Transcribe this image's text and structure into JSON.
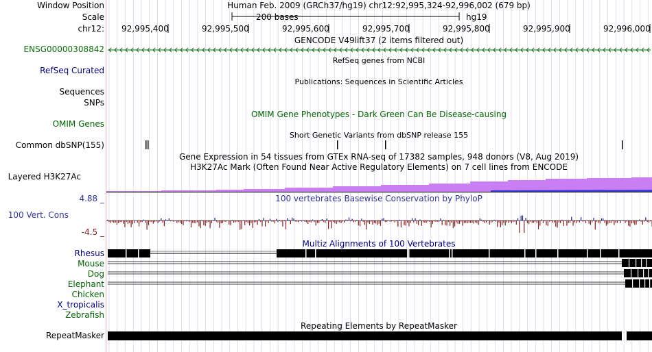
{
  "header": {
    "window_position_label": "Window Position",
    "window_position_value": "Human Feb. 2009 (GRCh37/hg19)   chr12:92,995,324-92,996,002 (679 bp)",
    "scale_label": "Scale",
    "scale_bar_text": "200 bases",
    "scale_assembly": "hg19",
    "chrom_label": "chr12:"
  },
  "ruler_ticks": [
    "92,995,400",
    "92,995,500",
    "92,995,600",
    "92,995,700",
    "92,995,800",
    "92,995,900",
    "92,996,000"
  ],
  "tracks": {
    "gencode": {
      "title": "GENCODE V49lift37 (2 items filtered out)",
      "item": "ENSG00000308842"
    },
    "refseq": {
      "label": "RefSeq Curated",
      "title": "RefSeq genes from NCBI"
    },
    "publications": {
      "label_line1": "Sequences",
      "label_line2": "SNPs",
      "title": "Publications: Sequences in Scientific Articles"
    },
    "omim": {
      "label": "OMIM Genes",
      "title": "OMIM Gene Phenotypes - Dark Green Can Be Disease-causing"
    },
    "dbsnp": {
      "label": "Common dbSNP(155)",
      "title": "Short Genetic Variants from dbSNP release 155"
    },
    "gtex": {
      "title": "Gene Expression in 54 tissues from GTEx RNA-seq of 17382 samples, 948 donors (V8, Aug 2019)"
    },
    "h3k27ac": {
      "label": "Layered H3K27Ac",
      "title": "H3K27Ac Mark (Often Found Near Active Regulatory Elements) on 7 cell lines from ENCODE"
    },
    "conservation": {
      "max_label": "4.88 _",
      "label": "100 Vert. Cons",
      "min_label": "-4.5 _",
      "title": "100 vertebrates Basewise Conservation by PhyloP"
    },
    "multiz": {
      "title": "Multiz Alignments of 100 Vertebrates",
      "species": [
        "Rhesus",
        "Mouse",
        "Dog",
        "Elephant",
        "Chicken",
        "X_tropicalis",
        "Zebrafish"
      ]
    },
    "repeatmasker": {
      "label": "RepeatMasker",
      "title": "Repeating Elements by RepeatMasker"
    }
  },
  "colors": {
    "grid": "#c8c8e6",
    "separator": "#e8b4b4",
    "gencode_green": "#0a6e0a",
    "h3k27ac_fill": "#c97ef2",
    "h3k27ac_blue": "#3b3bd6",
    "phylop_neg": "#8b1a1a",
    "phylop_pos": "#1a1a8b"
  }
}
